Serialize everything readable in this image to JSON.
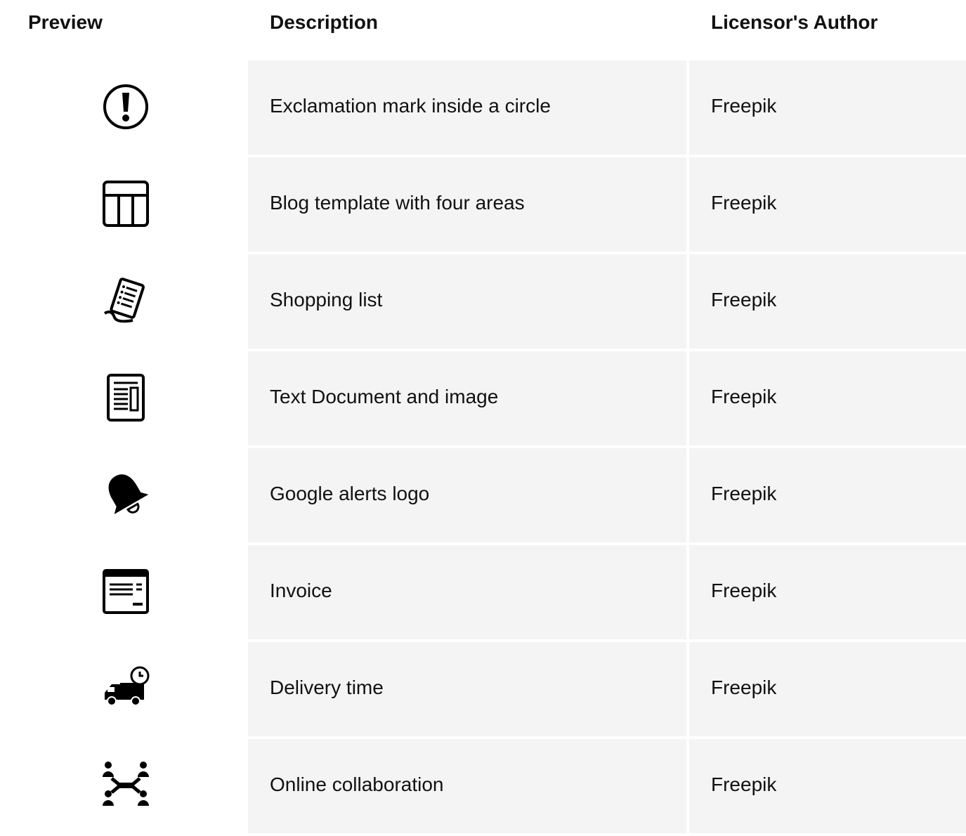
{
  "table": {
    "headers": {
      "preview": "Preview",
      "description": "Description",
      "author": "Licensor's Author"
    },
    "rows": [
      {
        "icon": "exclamation-circle-icon",
        "description": "Exclamation mark inside a circle",
        "author": "Freepik"
      },
      {
        "icon": "blog-template-icon",
        "description": "Blog template with four areas",
        "author": "Freepik"
      },
      {
        "icon": "shopping-list-icon",
        "description": "Shopping list",
        "author": "Freepik"
      },
      {
        "icon": "text-document-image-icon",
        "description": "Text Document and image",
        "author": "Freepik"
      },
      {
        "icon": "bell-alert-icon",
        "description": "Google alerts logo",
        "author": "Freepik"
      },
      {
        "icon": "invoice-icon",
        "description": "Invoice",
        "author": "Freepik"
      },
      {
        "icon": "delivery-time-icon",
        "description": "Delivery time",
        "author": "Freepik"
      },
      {
        "icon": "online-collaboration-icon",
        "description": "Online collaboration",
        "author": "Freepik"
      }
    ]
  },
  "colors": {
    "row_background": "#f4f4f4",
    "text": "#111111"
  }
}
